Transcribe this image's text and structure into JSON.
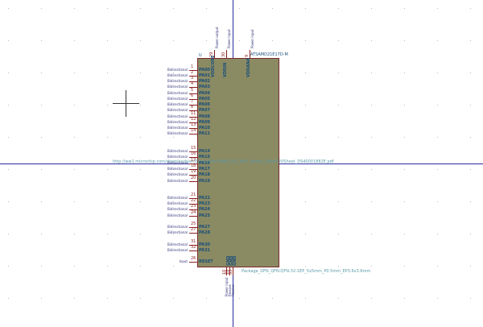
{
  "schematic": {
    "ref": "U",
    "value": "ATSAMD21E17D-M",
    "datasheet": "http://ww1.microchip.com/downloads/en/DeviceDoc/SAM_D21_DA1_Family_Data%20Sheet_DS40001882E.pdf",
    "footprint": "Package_DFN_QFN:QFN-32-1EP_5x5mm_P0.5mm_EP3.6x3.6mm",
    "colors": {
      "body": "#8a8a63",
      "outline": "#7a2b2b",
      "pin": "#8b1e1e",
      "axis": "#2a2aa0",
      "field": "#5a9aa8"
    },
    "left_pins": [
      {
        "type": "Bidirectional",
        "num": "1",
        "name": "PA00"
      },
      {
        "type": "Bidirectional",
        "num": "2",
        "name": "PA01"
      },
      {
        "type": "Bidirectional",
        "num": "3",
        "name": "PA02"
      },
      {
        "type": "Bidirectional",
        "num": "4",
        "name": "PA03"
      },
      {
        "type": "Bidirectional",
        "num": "5",
        "name": "PA04"
      },
      {
        "type": "Bidirectional",
        "num": "6",
        "name": "PA05"
      },
      {
        "type": "Bidirectional",
        "num": "7",
        "name": "PA06"
      },
      {
        "type": "Bidirectional",
        "num": "8",
        "name": "PA07"
      },
      {
        "type": "Bidirectional",
        "num": "11",
        "name": "PA08"
      },
      {
        "type": "Bidirectional",
        "num": "12",
        "name": "PA09"
      },
      {
        "type": "Bidirectional",
        "num": "13",
        "name": "PA10"
      },
      {
        "type": "Bidirectional",
        "num": "14",
        "name": "PA11"
      },
      {
        "type": "Bidirectional",
        "num": "15",
        "name": "PA14"
      },
      {
        "type": "Bidirectional",
        "num": "16",
        "name": "PA15"
      },
      {
        "type": "Bidirectional",
        "num": "17",
        "name": "PA16"
      },
      {
        "type": "Bidirectional",
        "num": "18",
        "name": "PA17"
      },
      {
        "type": "Bidirectional",
        "num": "19",
        "name": "PA18"
      },
      {
        "type": "Bidirectional",
        "num": "20",
        "name": "PA19"
      },
      {
        "type": "Bidirectional",
        "num": "21",
        "name": "PA22"
      },
      {
        "type": "Bidirectional",
        "num": "22",
        "name": "PA23"
      },
      {
        "type": "Bidirectional",
        "num": "23",
        "name": "PA24"
      },
      {
        "type": "Bidirectional",
        "num": "24",
        "name": "PA25"
      },
      {
        "type": "Bidirectional",
        "num": "25",
        "name": "PA27"
      },
      {
        "type": "Bidirectional",
        "num": "27",
        "name": "PA28"
      },
      {
        "type": "Bidirectional",
        "num": "31",
        "name": "PA30"
      },
      {
        "type": "Bidirectional",
        "num": "32",
        "name": "PA31"
      },
      {
        "type": "Input",
        "num": "26",
        "name": "RESET"
      }
    ],
    "top_pins": [
      {
        "type": "Power output",
        "num": "29",
        "name": "VDDCORE"
      },
      {
        "type": "Power input",
        "num": "30",
        "name": "VDDIN"
      },
      {
        "type": "Power input",
        "num": "9",
        "name": "VDDANA"
      }
    ],
    "bottom_pins": [
      {
        "type": "Power input",
        "num": "10",
        "name": "GND"
      },
      {
        "type": "Passive",
        "num": "28",
        "name": "GND"
      },
      {
        "type": "Passive",
        "num": "33",
        "name": "GND"
      }
    ]
  }
}
